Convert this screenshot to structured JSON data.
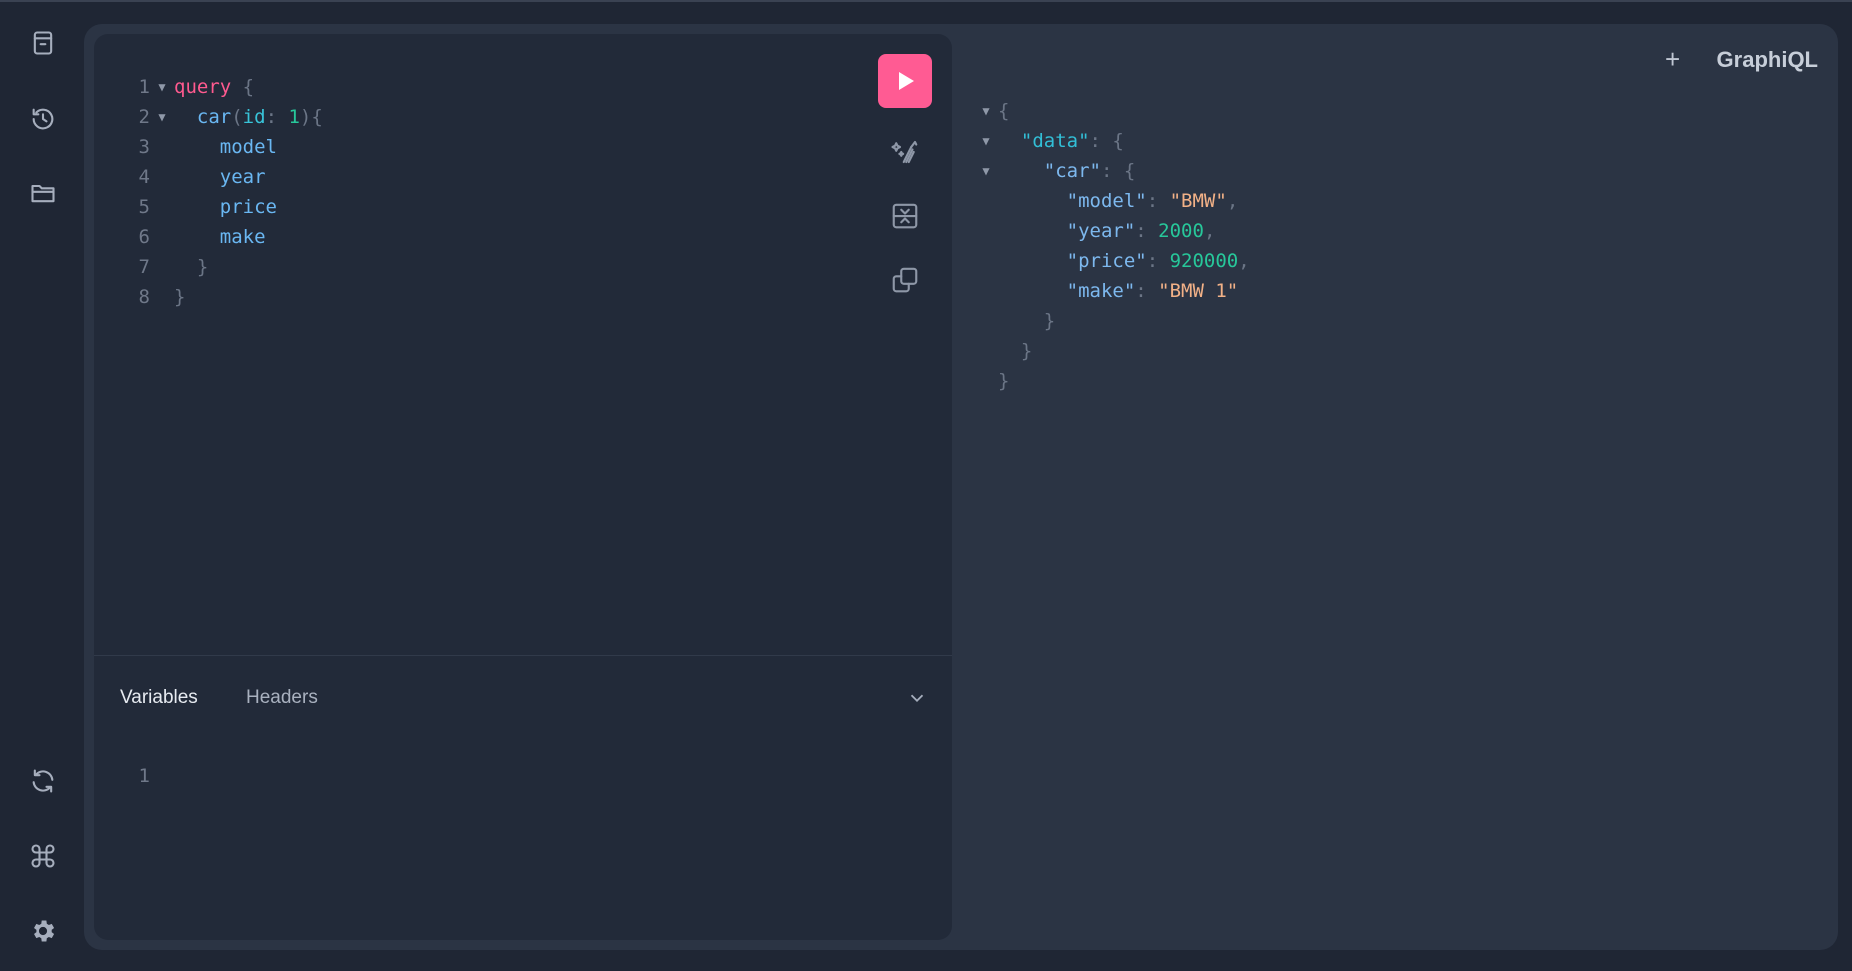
{
  "brand": {
    "title": "GraphiQL"
  },
  "sidebar": {
    "items": [
      {
        "name": "docs",
        "icon": "docs-icon"
      },
      {
        "name": "history",
        "icon": "history-icon"
      },
      {
        "name": "explorer",
        "icon": "folder-icon"
      },
      {
        "name": "refetch-schema",
        "icon": "refresh-icon"
      },
      {
        "name": "shortcuts",
        "icon": "command-icon"
      },
      {
        "name": "settings",
        "icon": "gear-icon"
      }
    ]
  },
  "query_editor": {
    "lines": [
      "1",
      "2",
      "3",
      "4",
      "5",
      "6",
      "7",
      "8"
    ],
    "tokens": {
      "query_kw": "query",
      "open_brace": "{",
      "car": "car",
      "open_paren": "(",
      "id": "id",
      "colon": ": ",
      "id_value": "1",
      "close_paren_brace": "){",
      "model": "model",
      "year": "year",
      "price": "price",
      "make": "make",
      "close_brace": "}"
    }
  },
  "variables_panel": {
    "tabs": [
      "Variables",
      "Headers"
    ],
    "line_number": "1"
  },
  "result": {
    "tokens": {
      "open": "{",
      "data_key": "\"data\"",
      "car_key": "\"car\"",
      "model_key": "\"model\"",
      "model_val": "\"BMW\"",
      "year_key": "\"year\"",
      "year_val": "2000",
      "price_key": "\"price\"",
      "price_val": "920000",
      "make_key": "\"make\"",
      "make_val": "\"BMW 1\"",
      "close": "}"
    }
  },
  "colors": {
    "run_button": "#ff5b93",
    "keyword": "#ff5a8f",
    "field": "#6ab7f2",
    "number": "#27c79a",
    "string": "#f2b187"
  }
}
